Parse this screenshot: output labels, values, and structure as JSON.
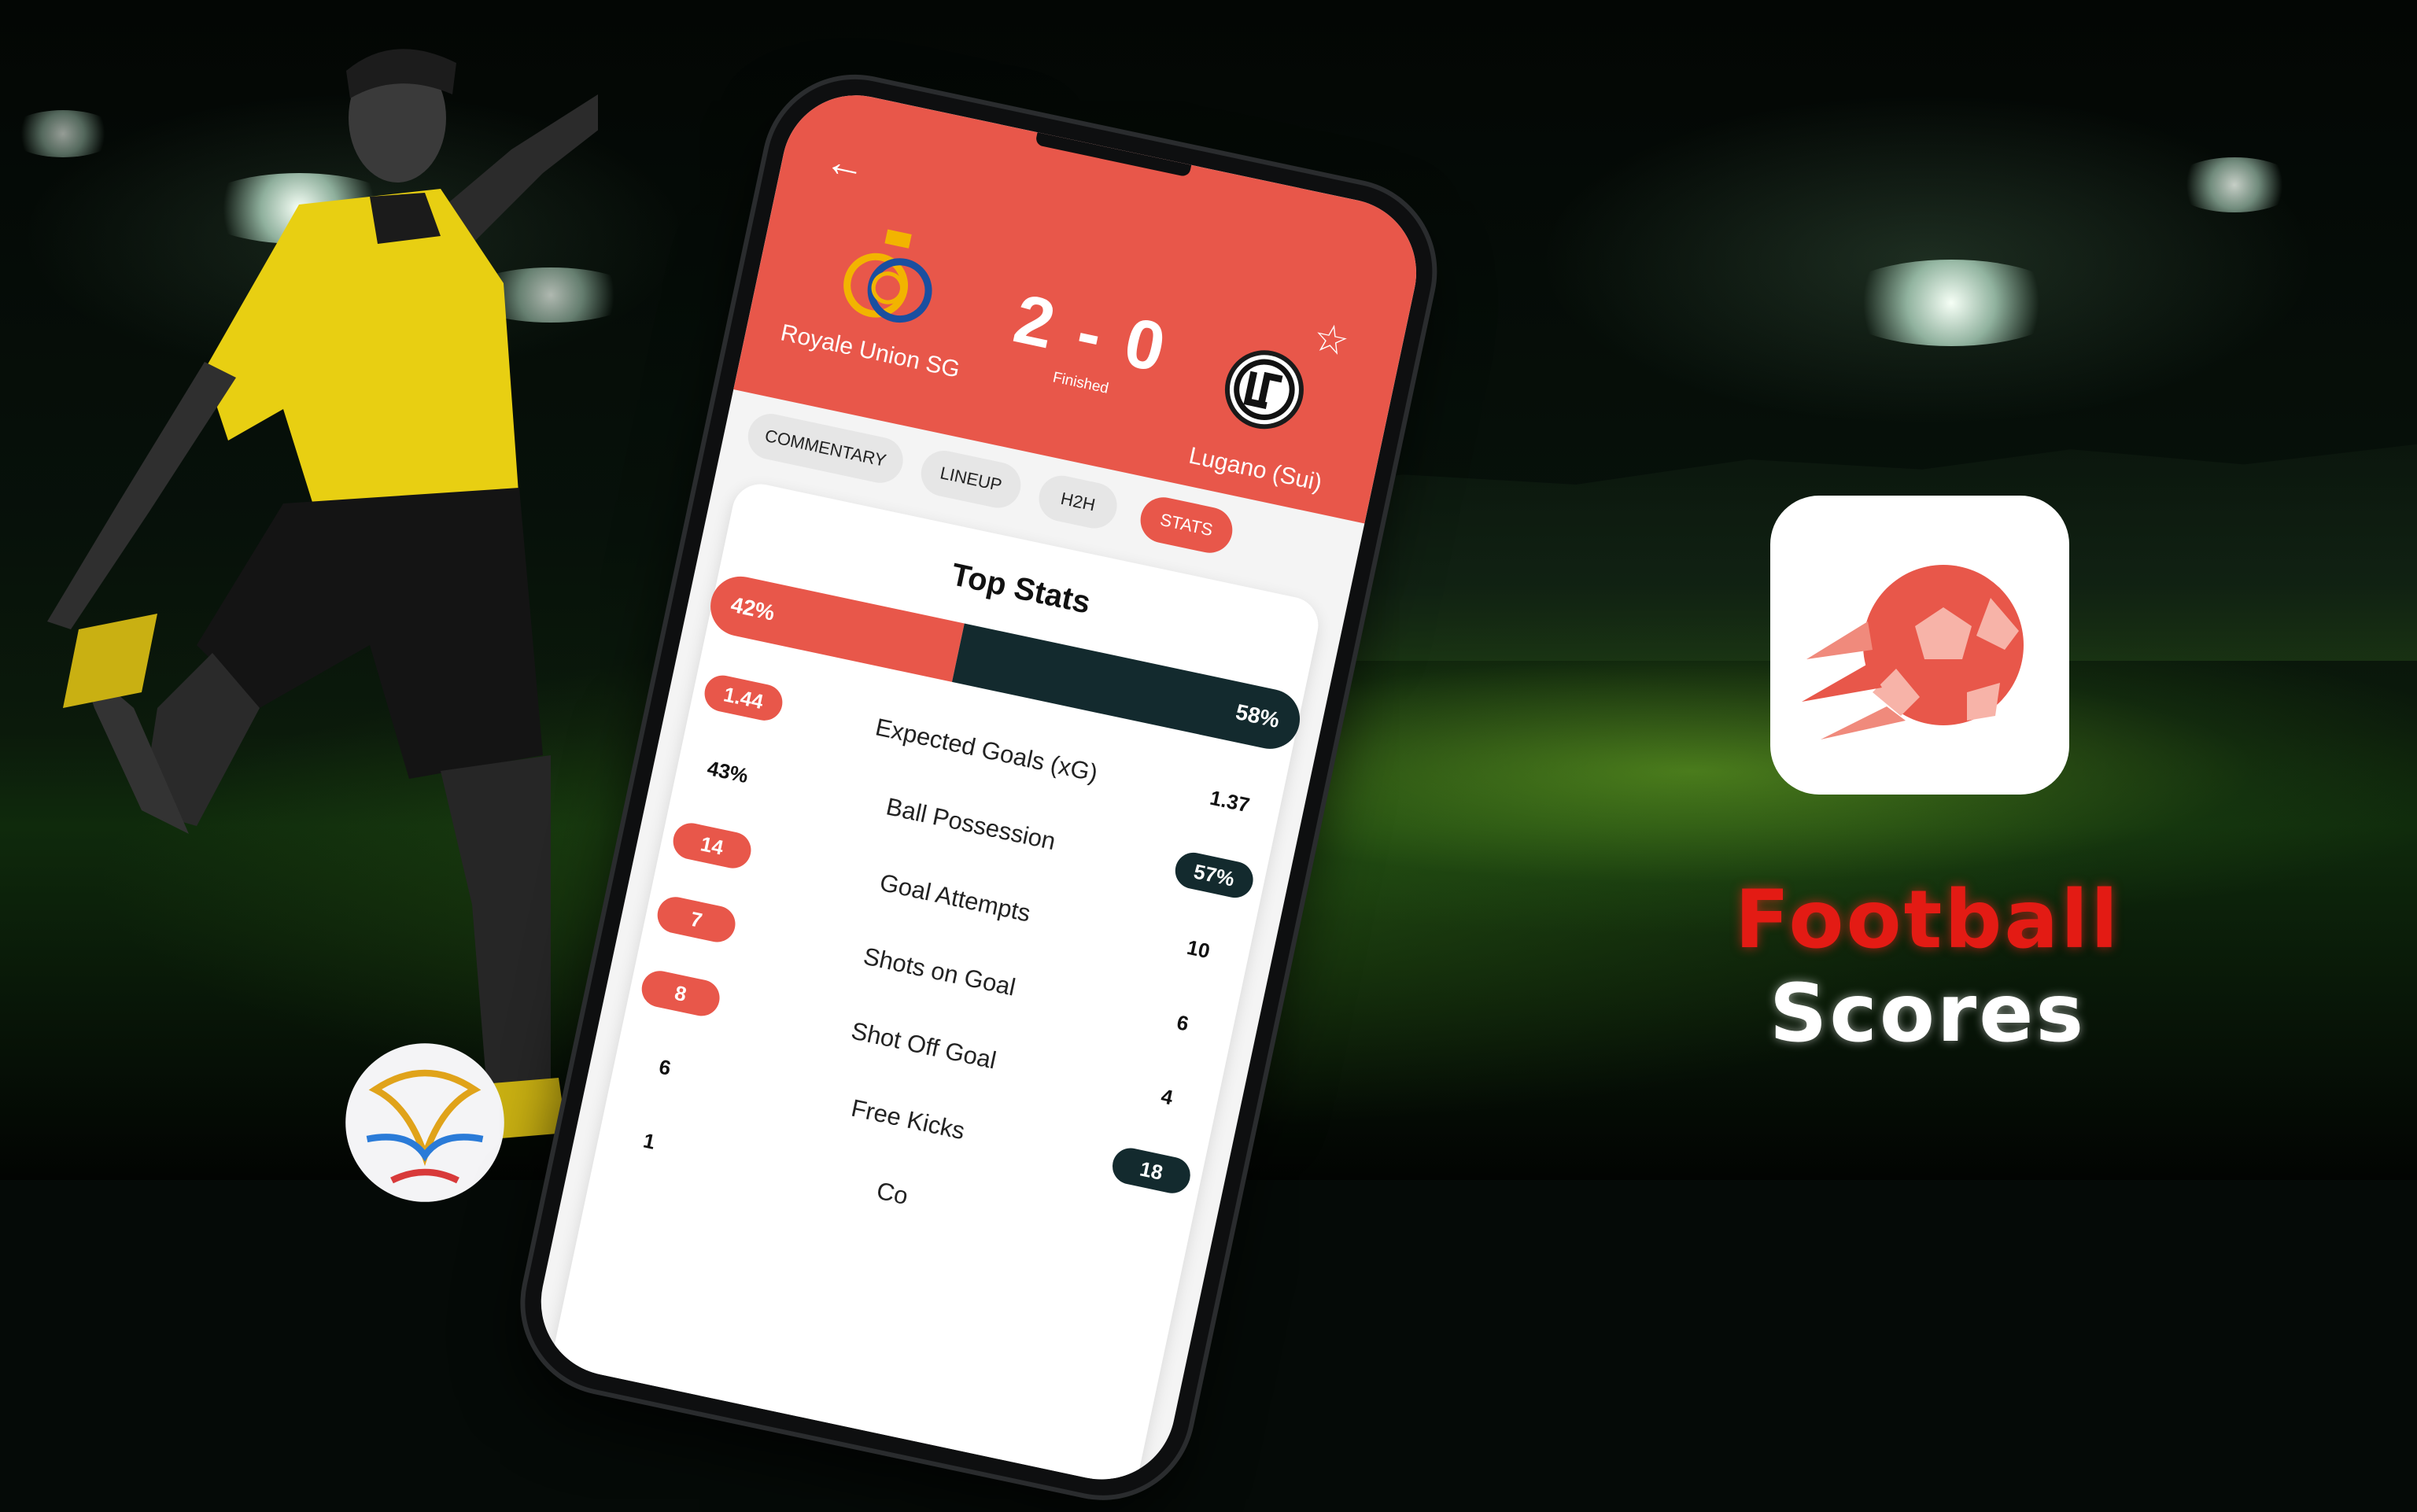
{
  "match": {
    "home_team": "Royale Union SG",
    "away_team": "Lugano (Sui)",
    "score": "2 - 0",
    "status": "Finished"
  },
  "tabs": [
    {
      "label": "COMMENTARY",
      "active": false
    },
    {
      "label": "LINEUP",
      "active": false
    },
    {
      "label": "H2H",
      "active": false
    },
    {
      "label": "STATS",
      "active": true
    }
  ],
  "top_stats": {
    "title": "Top Stats",
    "possession_bar": {
      "home": "42%",
      "away": "58%",
      "home_fraction": 0.42
    },
    "rows": [
      {
        "label": "Expected Goals (xG)",
        "home": "1.44",
        "away": "1.37",
        "highlight": "home"
      },
      {
        "label": "Ball Possession",
        "home": "43%",
        "away": "57%",
        "highlight": "away"
      },
      {
        "label": "Goal Attempts",
        "home": "14",
        "away": "10",
        "highlight": "home"
      },
      {
        "label": "Shots on Goal",
        "home": "7",
        "away": "6",
        "highlight": "home"
      },
      {
        "label": "Shot Off Goal",
        "home": "8",
        "away": "4",
        "highlight": "home"
      },
      {
        "label": "Free Kicks",
        "home": "6",
        "away": "18",
        "highlight": "away"
      },
      {
        "label": "Co",
        "home": "1",
        "away": "",
        "highlight": "none"
      }
    ]
  },
  "branding": {
    "word1": "Football",
    "word2": "Scores",
    "icon": "football-icon"
  },
  "icons": {
    "back": "back-arrow-icon",
    "favorite": "star-icon"
  },
  "colors": {
    "accent": "#e8574a",
    "dark": "#132a2e",
    "brand_red": "#e31b14"
  }
}
